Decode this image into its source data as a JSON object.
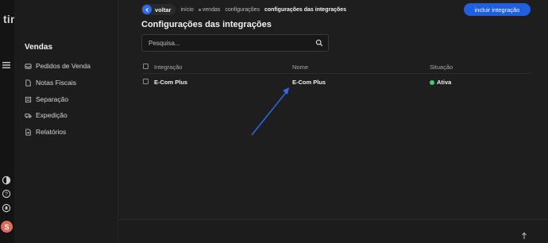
{
  "app": {
    "logo": "tiny",
    "logo_dot": "●"
  },
  "rail": {
    "icons": [
      "menu-icon",
      "contrast-icon",
      "help-icon",
      "bell-icon"
    ],
    "avatar_initial": "S"
  },
  "sidebar": {
    "title": "Vendas",
    "items": [
      {
        "label": "Pedidos de Venda",
        "icon": "inbox-icon"
      },
      {
        "label": "Notas Fiscais",
        "icon": "document-icon"
      },
      {
        "label": "Separação",
        "icon": "list-icon"
      },
      {
        "label": "Expedição",
        "icon": "truck-icon"
      },
      {
        "label": "Relatórios",
        "icon": "report-icon"
      }
    ]
  },
  "topbar": {
    "back_label": "voltar",
    "breadcrumb": [
      "início",
      "vendas",
      "configurações",
      "configurações das integrações"
    ],
    "primary_button": "incluir integração"
  },
  "page": {
    "title": "Configurações das integrações",
    "search_placeholder": "Pesquisa..."
  },
  "table": {
    "columns": [
      "Integração",
      "Nome",
      "Situação"
    ],
    "rows": [
      {
        "integracao": "E-Com Plus",
        "nome": "E-Com Plus",
        "situacao": "Ativa"
      }
    ]
  },
  "colors": {
    "accent": "#1f5fe0",
    "status_active": "#3ecf70",
    "annotation_arrow": "#2f6bf0"
  }
}
